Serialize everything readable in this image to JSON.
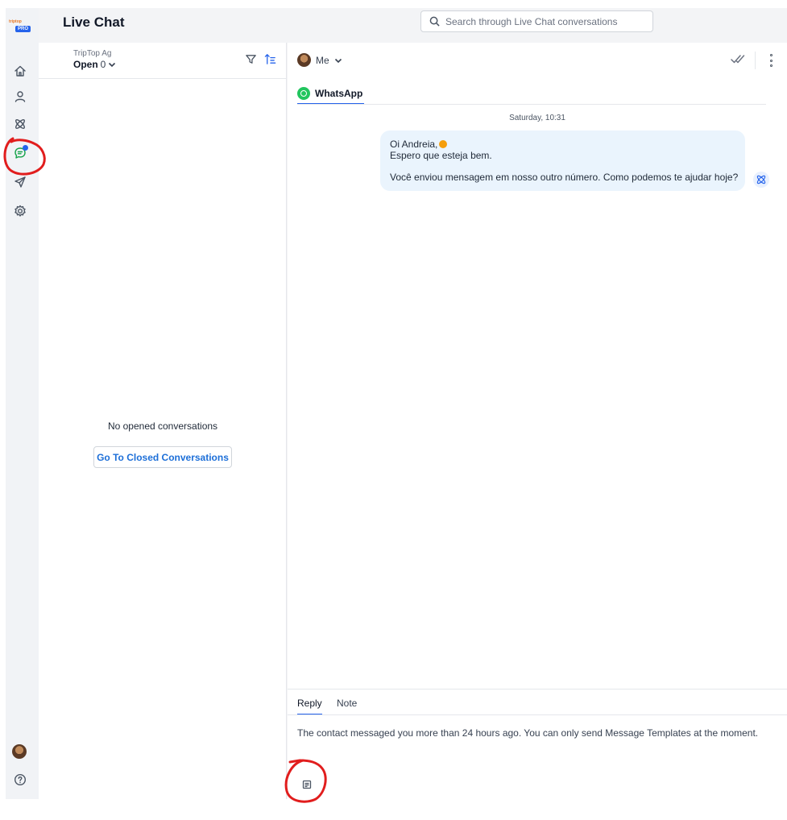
{
  "app": {
    "logo_text": "triptop",
    "logo_badge": "PRO",
    "title": "Live Chat"
  },
  "search": {
    "placeholder": "Search through Live Chat conversations"
  },
  "rail": {
    "items": [
      "home-icon",
      "contacts-icon",
      "automation-icon",
      "live-chat-icon",
      "campaigns-icon",
      "settings-icon"
    ],
    "active": "live-chat-icon"
  },
  "list": {
    "inbox_name": "TripTop Ag",
    "status_label": "Open",
    "status_count": "0",
    "empty_text": "No opened conversations",
    "closed_button": "Go To Closed Conversations"
  },
  "chat": {
    "assignee": "Me",
    "channel": "WhatsApp",
    "date_separator": "Saturday, 10:31",
    "message": {
      "line1": "Oi Andreia,",
      "line2": "Espero que esteja bem.",
      "line3": "Você enviou mensagem em nosso outro número. Como podemos te ajudar hoje?"
    }
  },
  "composer": {
    "tab_reply": "Reply",
    "tab_note": "Note",
    "notice": "The contact messaged you more than 24 hours ago. You can only send Message Templates at the moment."
  },
  "colors": {
    "accent": "#2563eb",
    "bubble": "#eaf4fd",
    "annotation": "#e11d1d",
    "whatsapp": "#22c55e"
  }
}
